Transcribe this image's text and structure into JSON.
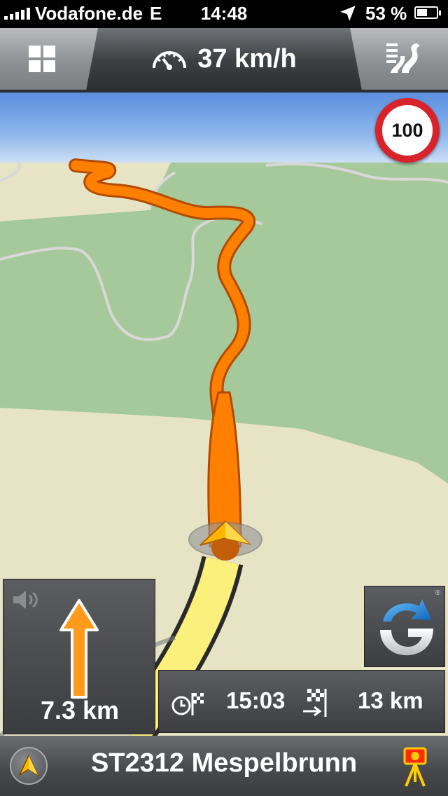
{
  "status_bar": {
    "carrier": "Vodafone.de",
    "network": "E",
    "time": "14:48",
    "battery_percent": "53 %",
    "battery_level": 0.53,
    "icons": [
      "signal-bars-icon",
      "location-arrow-icon",
      "battery-icon"
    ]
  },
  "top_bar": {
    "speed": "37 km/h",
    "menu_icon": "grid-menu-icon",
    "speedometer_icon": "speedometer-icon",
    "route_icon": "route-lanes-icon"
  },
  "map": {
    "speed_limit": "100",
    "colors": {
      "route": "#ff7f00",
      "traveled": "#fcf07c",
      "forest": "#a6c99b",
      "field": "#e7e4c6",
      "sky": "#7aa9e6"
    }
  },
  "turn_panel": {
    "distance": "7.3 km",
    "direction_icon": "straight-arrow-icon",
    "speaker_icon": "speaker-icon"
  },
  "info_panel": {
    "arrival_time": "15:03",
    "remaining_distance": "13 km",
    "arrival_icon": "clock-flag-icon",
    "distance_icon": "finish-flag-icon"
  },
  "nav_button": {
    "icon": "navigon-logo-icon",
    "reg_mark": "®"
  },
  "bottom_bar": {
    "street": "ST2312 Mespelbrunn",
    "compass_icon": "compass-icon",
    "camera_icon": "speed-camera-icon"
  }
}
